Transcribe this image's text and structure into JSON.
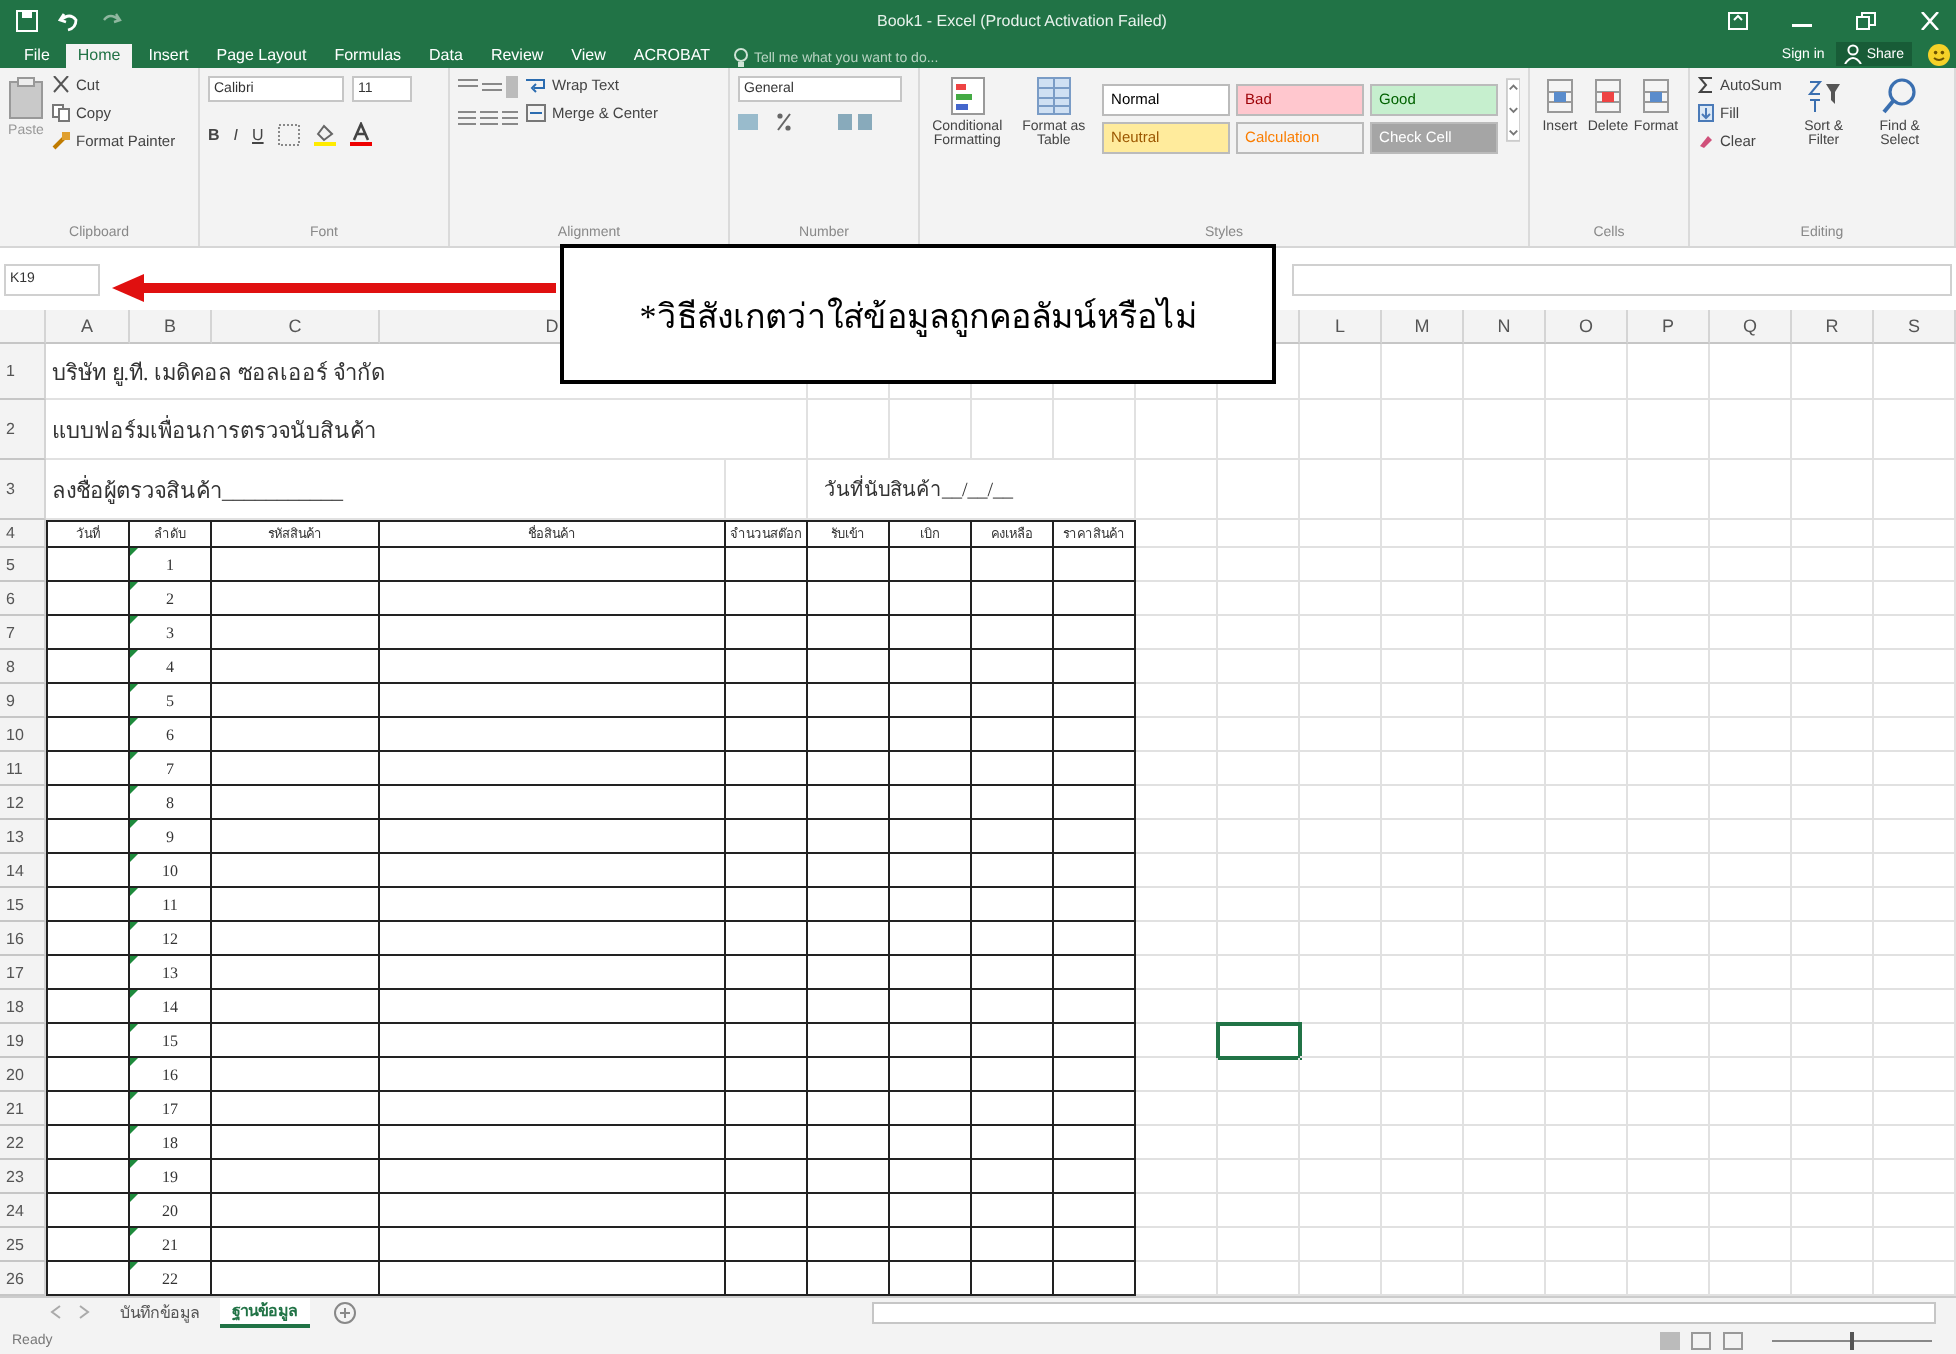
{
  "window": {
    "title": "Book1 - Excel (Product Activation Failed)"
  },
  "menu_tabs": [
    {
      "label": "File",
      "selected": false
    },
    {
      "label": "Home",
      "selected": true
    },
    {
      "label": "Insert",
      "selected": false
    },
    {
      "label": "Page Layout",
      "selected": false
    },
    {
      "label": "Formulas",
      "selected": false
    },
    {
      "label": "Data",
      "selected": false
    },
    {
      "label": "Review",
      "selected": false
    },
    {
      "label": "View",
      "selected": false
    },
    {
      "label": "ACROBAT",
      "selected": false
    }
  ],
  "tell_me": {
    "placeholder": "Tell me what you want to do..."
  },
  "account": {
    "sign_in": "Sign in",
    "share": "Share"
  },
  "clipboard": {
    "label": "Clipboard",
    "paste": "Paste",
    "cut": "Cut",
    "copy": "Copy",
    "format_painter": "Format Painter"
  },
  "font": {
    "label": "Font",
    "name": "Calibri",
    "size": "11",
    "format_buttons": [
      "B",
      "I",
      "U"
    ]
  },
  "alignment": {
    "label": "Alignment",
    "wrap": "Wrap Text",
    "merge": "Merge & Center"
  },
  "number": {
    "label": "Number",
    "format": "General"
  },
  "styles": {
    "label": "Styles",
    "conditional": "Conditional Formatting",
    "table": "Format as Table",
    "cells": [
      {
        "label": "Normal",
        "color": "#ffffff",
        "kind": "plain"
      },
      {
        "label": "Bad",
        "color": "#ffc7ce",
        "kind": "bad"
      },
      {
        "label": "Good",
        "color": "#c6efce",
        "kind": "good"
      },
      {
        "label": "Neutral",
        "color": "#ffeb9c",
        "kind": "neutral"
      },
      {
        "label": "Calculation",
        "color": "#f2f2f2",
        "kind": "calculation"
      },
      {
        "label": "Check Cell",
        "color": "#a5a5a5",
        "kind": "check"
      }
    ]
  },
  "cells_group": {
    "label": "Cells",
    "buttons": [
      "Insert",
      "Delete",
      "Format"
    ]
  },
  "editing": {
    "label": "Editing",
    "autosum": "AutoSum",
    "fill": "Fill",
    "clear": "Clear",
    "sort": "Sort & Filter",
    "find": "Find & Select"
  },
  "name_box": "K19",
  "callout": "*วิธีสังเกตว่าใส่ข้อมูลถูกคอลัมน์หรือไม่",
  "sheet": {
    "columns_left": [
      "A",
      "B",
      "C",
      "D"
    ],
    "columns_right": [
      "L",
      "M",
      "N",
      "O",
      "P",
      "Q",
      "R",
      "S"
    ],
    "title_rows": [
      {
        "number": "1",
        "text": "บริษัท ยู.ที. เมดิคอล ซอลเออร์ จำกัด"
      },
      {
        "number": "2",
        "text": "แบบฟอร์มเพื่อนการตรวจนับสินค้า"
      }
    ],
    "signature_row": {
      "number": "3",
      "signer": "ลงชื่อผู้ตรวจสินค้า___________",
      "date": "วันที่นับสินค้า__/__/__"
    },
    "header_row": {
      "number": "4",
      "columns": [
        "วันที่",
        "ลำดับ",
        "รหัสสินค้า",
        "ชื่อสินค้า",
        "จำนวนสต๊อก",
        "รับเข้า",
        "เบิก",
        "คงเหลือ",
        "ราคาสินค้า"
      ]
    },
    "rows": [
      {
        "number": "5",
        "index": "1",
        "cursor": false
      },
      {
        "number": "6",
        "index": "2",
        "cursor": false
      },
      {
        "number": "7",
        "index": "3",
        "cursor": false
      },
      {
        "number": "8",
        "index": "4",
        "cursor": false
      },
      {
        "number": "9",
        "index": "5",
        "cursor": false
      },
      {
        "number": "10",
        "index": "6",
        "cursor": false
      },
      {
        "number": "11",
        "index": "7",
        "cursor": false
      },
      {
        "number": "12",
        "index": "8",
        "cursor": false
      },
      {
        "number": "13",
        "index": "9",
        "cursor": false
      },
      {
        "number": "14",
        "index": "10",
        "cursor": false
      },
      {
        "number": "15",
        "index": "11",
        "cursor": false
      },
      {
        "number": "16",
        "index": "12",
        "cursor": false
      },
      {
        "number": "17",
        "index": "13",
        "cursor": false
      },
      {
        "number": "18",
        "index": "14",
        "cursor": false
      },
      {
        "number": "19",
        "index": "15",
        "cursor": true
      },
      {
        "number": "20",
        "index": "16",
        "cursor": false
      },
      {
        "number": "21",
        "index": "17",
        "cursor": false
      },
      {
        "number": "22",
        "index": "18",
        "cursor": false
      },
      {
        "number": "23",
        "index": "19",
        "cursor": false
      },
      {
        "number": "24",
        "index": "20",
        "cursor": false
      },
      {
        "number": "25",
        "index": "21",
        "cursor": false
      },
      {
        "number": "26",
        "index": "22",
        "cursor": false
      }
    ]
  },
  "sheet_tabs": [
    {
      "label": "บันทึกข้อมูล",
      "selected": false
    },
    {
      "label": "ฐานข้อมูล",
      "selected": true
    }
  ],
  "status_bar": {
    "text": "Ready",
    "zoom": {
      "level": 0.5
    }
  }
}
